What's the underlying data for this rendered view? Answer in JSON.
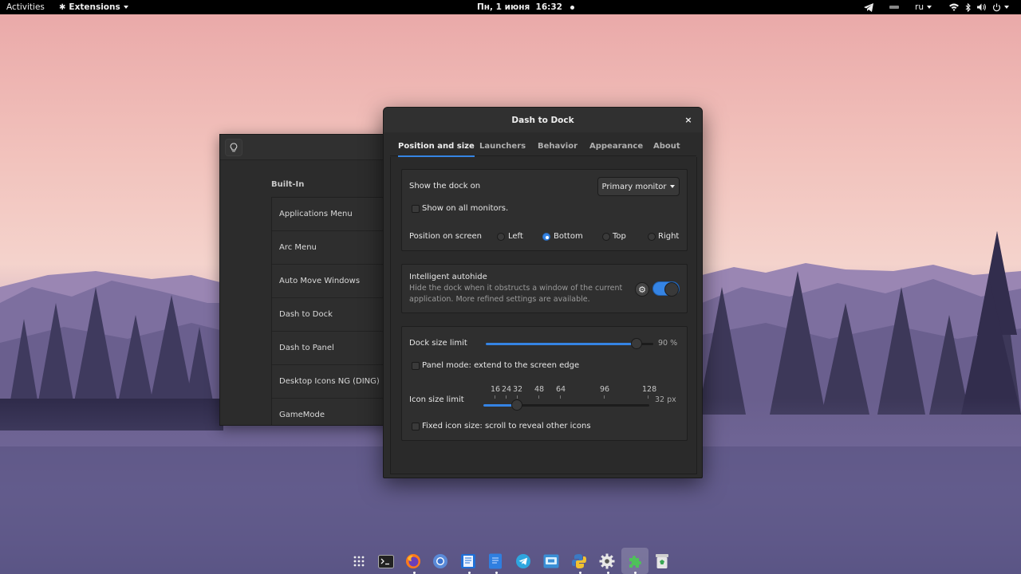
{
  "topbar": {
    "activities": "Activities",
    "extensions": "Extensions",
    "clock": "Пн, 1 июня  16:32",
    "language": "ru"
  },
  "extensions_window": {
    "section_title": "Built-In",
    "items": [
      "Applications Menu",
      "Arc Menu",
      "Auto Move Windows",
      "Dash to Dock",
      "Dash to Panel",
      "Desktop Icons NG (DING)",
      "GameMode"
    ]
  },
  "dialog": {
    "title": "Dash to Dock",
    "close": "×",
    "tabs": [
      "Position and size",
      "Launchers",
      "Behavior",
      "Appearance",
      "About"
    ],
    "active_tab": "Position and size",
    "show_dock_on": {
      "label": "Show the dock on",
      "selected": "Primary monitor"
    },
    "show_all_monitors": {
      "label": "Show on all monitors.",
      "checked": false
    },
    "position": {
      "label": "Position on screen",
      "options": [
        "Left",
        "Bottom",
        "Top",
        "Right"
      ],
      "selected": "Bottom"
    },
    "autohide": {
      "title": "Intelligent autohide",
      "description_line1": "Hide the dock when it obstructs a window of the current",
      "description_line2": "application. More refined settings are available.",
      "enabled": true
    },
    "dock_size": {
      "label": "Dock size limit",
      "value_text": "90 %",
      "fraction": 0.9
    },
    "panel_mode": {
      "label": "Panel mode: extend to the screen edge",
      "checked": false
    },
    "icon_size": {
      "label": "Icon size limit",
      "ticks": [
        "16",
        "24",
        "32",
        "48",
        "64",
        "96",
        "128"
      ],
      "value_text": "32 px",
      "value": 32
    },
    "fixed_icon": {
      "label": "Fixed icon size: scroll to reveal other icons",
      "checked": false
    }
  },
  "dock": {
    "icons": [
      "apps-grid-icon",
      "terminal-icon",
      "firefox-icon",
      "chromium-icon",
      "text-editor-icon",
      "document-icon",
      "telegram-icon",
      "remote-desktop-icon",
      "python-icon",
      "settings-icon",
      "extensions-icon",
      "trash-icon"
    ]
  }
}
